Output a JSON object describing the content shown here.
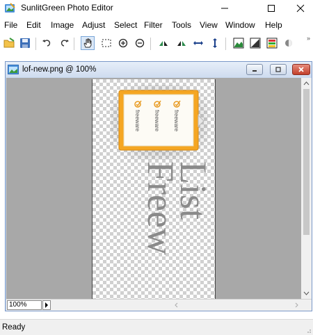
{
  "window": {
    "title": "SunlitGreen Photo Editor"
  },
  "menu": {
    "items": [
      {
        "label": "File"
      },
      {
        "label": "Edit"
      },
      {
        "label": "Image"
      },
      {
        "label": "Adjust"
      },
      {
        "label": "Select"
      },
      {
        "label": "Filter"
      },
      {
        "label": "Tools"
      },
      {
        "label": "View"
      },
      {
        "label": "Window"
      },
      {
        "label": "Help"
      }
    ]
  },
  "toolbar": {
    "tools": [
      {
        "name": "open-icon"
      },
      {
        "name": "save-icon"
      },
      {
        "name": "undo-icon"
      },
      {
        "name": "redo-icon"
      },
      {
        "name": "hand-pan-icon",
        "active": true
      },
      {
        "name": "rect-select-icon"
      },
      {
        "name": "zoom-in-icon"
      },
      {
        "name": "zoom-out-icon"
      },
      {
        "name": "flip-vertical-icon"
      },
      {
        "name": "flip-horizontal-icon"
      },
      {
        "name": "resize-width-icon"
      },
      {
        "name": "resize-height-icon"
      },
      {
        "name": "image-adjust-icon"
      },
      {
        "name": "levels-icon"
      },
      {
        "name": "color-palette-icon"
      },
      {
        "name": "brightness-icon"
      }
    ],
    "overflow": "»"
  },
  "document": {
    "title": "lof-new.png @ 100%",
    "zoom": "100%",
    "image": {
      "label_text": "freeware",
      "vertical_text_top": "List",
      "vertical_text_bottom": "Freew"
    }
  },
  "status": {
    "text": "Ready"
  },
  "colors": {
    "accent_orange": "#f5a623",
    "title_blue": "#2f6db5",
    "close_red": "#c2402c"
  }
}
